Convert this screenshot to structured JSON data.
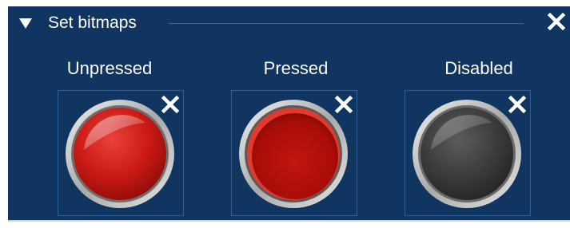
{
  "panel": {
    "title": "Set bitmaps",
    "background_color": "#0f3560",
    "arrow_icon": "triangle-down-icon",
    "close_icon": "close-icon"
  },
  "states": [
    {
      "label": "Unpressed",
      "button_color": "#d01c18",
      "icon": "red-round-button"
    },
    {
      "label": "Pressed",
      "button_color": "#b80f0a",
      "icon": "dark-red-round-button"
    },
    {
      "label": "Disabled",
      "button_color": "#3d3d3d",
      "icon": "gray-round-button"
    }
  ]
}
